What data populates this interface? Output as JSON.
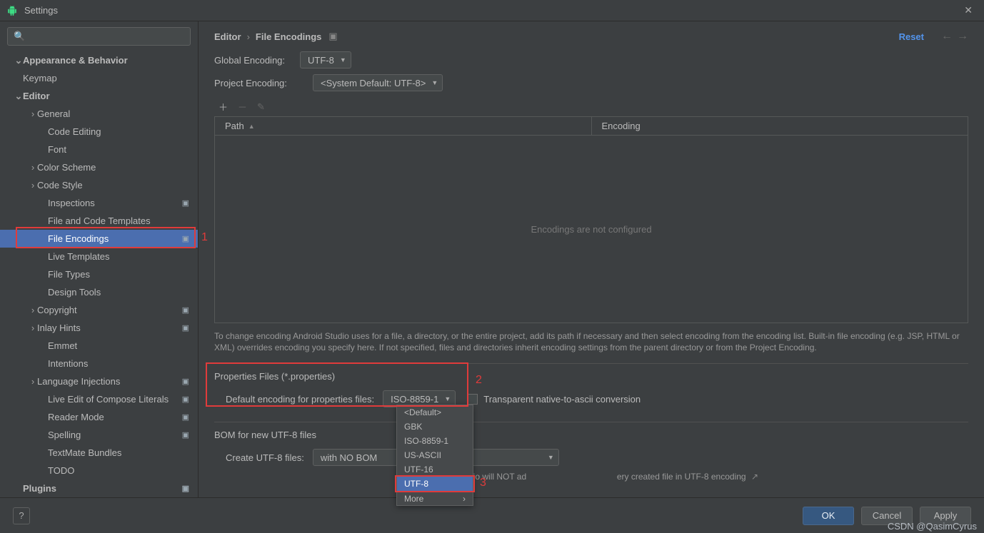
{
  "window": {
    "title": "Settings"
  },
  "search": {
    "placeholder": "Q"
  },
  "sidebar": {
    "items": [
      {
        "label": "Appearance & Behavior",
        "level": 0,
        "arrow": "v",
        "top": true
      },
      {
        "label": "Keymap",
        "level": 0
      },
      {
        "label": "Editor",
        "level": 0,
        "arrow": "v",
        "top": true
      },
      {
        "label": "General",
        "level": 1,
        "arrow": ">"
      },
      {
        "label": "Code Editing",
        "level": 2
      },
      {
        "label": "Font",
        "level": 2
      },
      {
        "label": "Color Scheme",
        "level": 1,
        "arrow": ">"
      },
      {
        "label": "Code Style",
        "level": 1,
        "arrow": ">"
      },
      {
        "label": "Inspections",
        "level": 2,
        "proj": true
      },
      {
        "label": "File and Code Templates",
        "level": 2
      },
      {
        "label": "File Encodings",
        "level": 2,
        "proj": true,
        "selected": true
      },
      {
        "label": "Live Templates",
        "level": 2
      },
      {
        "label": "File Types",
        "level": 2
      },
      {
        "label": "Design Tools",
        "level": 2
      },
      {
        "label": "Copyright",
        "level": 1,
        "arrow": ">",
        "proj": true
      },
      {
        "label": "Inlay Hints",
        "level": 1,
        "arrow": ">",
        "proj": true
      },
      {
        "label": "Emmet",
        "level": 2
      },
      {
        "label": "Intentions",
        "level": 2
      },
      {
        "label": "Language Injections",
        "level": 1,
        "arrow": ">",
        "proj": true
      },
      {
        "label": "Live Edit of Compose Literals",
        "level": 2,
        "proj": true
      },
      {
        "label": "Reader Mode",
        "level": 2,
        "proj": true
      },
      {
        "label": "Spelling",
        "level": 2,
        "proj": true
      },
      {
        "label": "TextMate Bundles",
        "level": 2
      },
      {
        "label": "TODO",
        "level": 2
      },
      {
        "label": "Plugins",
        "level": 0,
        "top": true,
        "proj": true
      }
    ]
  },
  "breadcrumb": {
    "a": "Editor",
    "b": "File Encodings",
    "reset": "Reset"
  },
  "enc": {
    "global_label": "Global Encoding:",
    "global_value": "UTF-8",
    "project_label": "Project Encoding:",
    "project_value": "<System Default: UTF-8>",
    "table": {
      "col_path": "Path",
      "col_enc": "Encoding",
      "empty": "Encodings are not configured"
    },
    "hint": "To change encoding Android Studio uses for a file, a directory, or the entire project, add its path if necessary and then select encoding from the encoding list. Built-in file encoding (e.g. JSP, HTML or XML) overrides encoding you specify here. If not specified, files and directories inherit encoding settings from the parent directory or from the Project Encoding.",
    "props_title": "Properties Files (*.properties)",
    "props_label": "Default encoding for properties files:",
    "props_value": "ISO-8859-1",
    "props_cbx": "Transparent native-to-ascii conversion",
    "bom_title": "BOM for new UTF-8 files",
    "bom_label": "Create UTF-8 files:",
    "bom_value": "with NO BOM",
    "bom_note": "Studio will NOT ad",
    "bom_note2": "ery created file in UTF-8 encoding"
  },
  "popup": {
    "options": [
      "<Default>",
      "GBK",
      "ISO-8859-1",
      "US-ASCII",
      "UTF-16",
      "UTF-8"
    ],
    "selected_index": 5,
    "more": "More"
  },
  "buttons": {
    "ok": "OK",
    "cancel": "Cancel",
    "apply": "Apply"
  },
  "annotations": {
    "a1": "1",
    "a2": "2",
    "a3": "3"
  },
  "watermark": "CSDN @QasimCyrus"
}
